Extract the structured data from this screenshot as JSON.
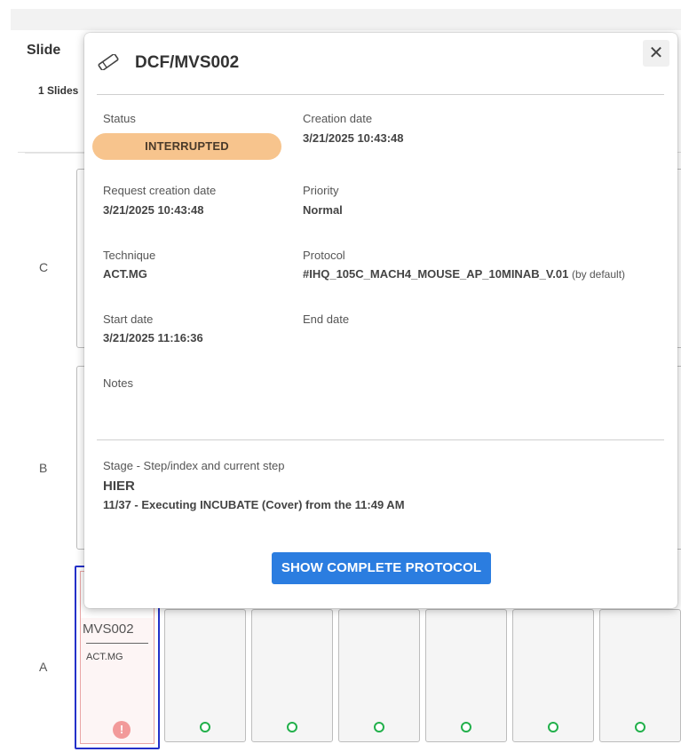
{
  "background": {
    "section_title": "Slide",
    "tab_label": "1 Slides",
    "row_labels": [
      "C",
      "B",
      "A"
    ],
    "slide": {
      "name": "MVS002",
      "technique": "ACT.MG",
      "status_icon": "exclamation-circle-icon"
    },
    "empty_slot_icon": "green-circle-icon",
    "empty_slot_count": 6
  },
  "modal": {
    "header_icon": "slide-icon",
    "title": "DCF/MVS002",
    "close_label": "✕",
    "fields": {
      "status": {
        "label": "Status",
        "value": "INTERRUPTED"
      },
      "creation_date": {
        "label": "Creation date",
        "value": "3/21/2025 10:43:48"
      },
      "request_creation_date": {
        "label": "Request creation date",
        "value": "3/21/2025 10:43:48"
      },
      "priority": {
        "label": "Priority",
        "value": "Normal"
      },
      "technique": {
        "label": "Technique",
        "value": "ACT.MG"
      },
      "protocol": {
        "label": "Protocol",
        "value": "#IHQ_105C_MACH4_MOUSE_AP_10MINAB_V.01",
        "note": "(by default)"
      },
      "start_date": {
        "label": "Start date",
        "value": "3/21/2025 11:16:36"
      },
      "end_date": {
        "label": "End date",
        "value": ""
      },
      "notes": {
        "label": "Notes",
        "value": ""
      }
    },
    "stage": {
      "label": "Stage - Step/index and current step",
      "name": "HIER",
      "step": "11/37 - Executing INCUBATE (Cover) from the 11:49 AM"
    },
    "primary_button": "SHOW COMPLETE PROTOCOL"
  },
  "colors": {
    "status_interrupted": "#f7c48d",
    "primary_button": "#2b7de0",
    "slot_ok": "#22b04b",
    "selected_border": "#2431c9",
    "warning": "#f29a9a"
  }
}
